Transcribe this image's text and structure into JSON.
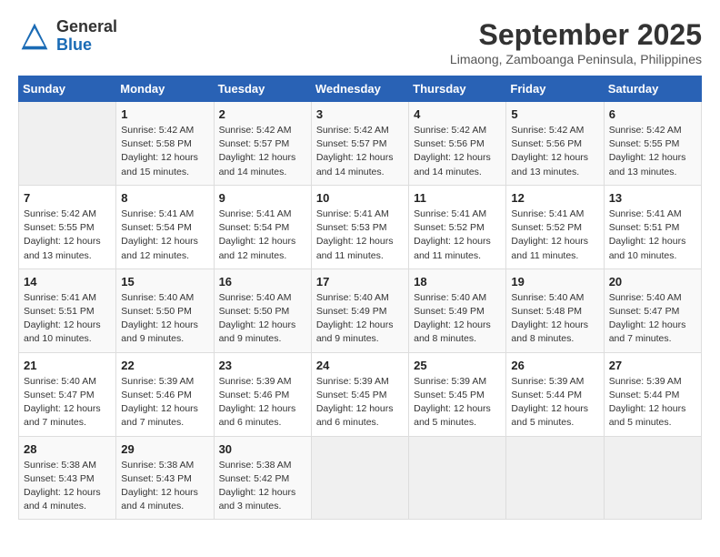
{
  "header": {
    "logo_general": "General",
    "logo_blue": "Blue",
    "month_title": "September 2025",
    "location": "Limaong, Zamboanga Peninsula, Philippines"
  },
  "days_of_week": [
    "Sunday",
    "Monday",
    "Tuesday",
    "Wednesday",
    "Thursday",
    "Friday",
    "Saturday"
  ],
  "weeks": [
    [
      {
        "day": "",
        "info": ""
      },
      {
        "day": "1",
        "info": "Sunrise: 5:42 AM\nSunset: 5:58 PM\nDaylight: 12 hours\nand 15 minutes."
      },
      {
        "day": "2",
        "info": "Sunrise: 5:42 AM\nSunset: 5:57 PM\nDaylight: 12 hours\nand 14 minutes."
      },
      {
        "day": "3",
        "info": "Sunrise: 5:42 AM\nSunset: 5:57 PM\nDaylight: 12 hours\nand 14 minutes."
      },
      {
        "day": "4",
        "info": "Sunrise: 5:42 AM\nSunset: 5:56 PM\nDaylight: 12 hours\nand 14 minutes."
      },
      {
        "day": "5",
        "info": "Sunrise: 5:42 AM\nSunset: 5:56 PM\nDaylight: 12 hours\nand 13 minutes."
      },
      {
        "day": "6",
        "info": "Sunrise: 5:42 AM\nSunset: 5:55 PM\nDaylight: 12 hours\nand 13 minutes."
      }
    ],
    [
      {
        "day": "7",
        "info": "Sunrise: 5:42 AM\nSunset: 5:55 PM\nDaylight: 12 hours\nand 13 minutes."
      },
      {
        "day": "8",
        "info": "Sunrise: 5:41 AM\nSunset: 5:54 PM\nDaylight: 12 hours\nand 12 minutes."
      },
      {
        "day": "9",
        "info": "Sunrise: 5:41 AM\nSunset: 5:54 PM\nDaylight: 12 hours\nand 12 minutes."
      },
      {
        "day": "10",
        "info": "Sunrise: 5:41 AM\nSunset: 5:53 PM\nDaylight: 12 hours\nand 11 minutes."
      },
      {
        "day": "11",
        "info": "Sunrise: 5:41 AM\nSunset: 5:52 PM\nDaylight: 12 hours\nand 11 minutes."
      },
      {
        "day": "12",
        "info": "Sunrise: 5:41 AM\nSunset: 5:52 PM\nDaylight: 12 hours\nand 11 minutes."
      },
      {
        "day": "13",
        "info": "Sunrise: 5:41 AM\nSunset: 5:51 PM\nDaylight: 12 hours\nand 10 minutes."
      }
    ],
    [
      {
        "day": "14",
        "info": "Sunrise: 5:41 AM\nSunset: 5:51 PM\nDaylight: 12 hours\nand 10 minutes."
      },
      {
        "day": "15",
        "info": "Sunrise: 5:40 AM\nSunset: 5:50 PM\nDaylight: 12 hours\nand 9 minutes."
      },
      {
        "day": "16",
        "info": "Sunrise: 5:40 AM\nSunset: 5:50 PM\nDaylight: 12 hours\nand 9 minutes."
      },
      {
        "day": "17",
        "info": "Sunrise: 5:40 AM\nSunset: 5:49 PM\nDaylight: 12 hours\nand 9 minutes."
      },
      {
        "day": "18",
        "info": "Sunrise: 5:40 AM\nSunset: 5:49 PM\nDaylight: 12 hours\nand 8 minutes."
      },
      {
        "day": "19",
        "info": "Sunrise: 5:40 AM\nSunset: 5:48 PM\nDaylight: 12 hours\nand 8 minutes."
      },
      {
        "day": "20",
        "info": "Sunrise: 5:40 AM\nSunset: 5:47 PM\nDaylight: 12 hours\nand 7 minutes."
      }
    ],
    [
      {
        "day": "21",
        "info": "Sunrise: 5:40 AM\nSunset: 5:47 PM\nDaylight: 12 hours\nand 7 minutes."
      },
      {
        "day": "22",
        "info": "Sunrise: 5:39 AM\nSunset: 5:46 PM\nDaylight: 12 hours\nand 7 minutes."
      },
      {
        "day": "23",
        "info": "Sunrise: 5:39 AM\nSunset: 5:46 PM\nDaylight: 12 hours\nand 6 minutes."
      },
      {
        "day": "24",
        "info": "Sunrise: 5:39 AM\nSunset: 5:45 PM\nDaylight: 12 hours\nand 6 minutes."
      },
      {
        "day": "25",
        "info": "Sunrise: 5:39 AM\nSunset: 5:45 PM\nDaylight: 12 hours\nand 5 minutes."
      },
      {
        "day": "26",
        "info": "Sunrise: 5:39 AM\nSunset: 5:44 PM\nDaylight: 12 hours\nand 5 minutes."
      },
      {
        "day": "27",
        "info": "Sunrise: 5:39 AM\nSunset: 5:44 PM\nDaylight: 12 hours\nand 5 minutes."
      }
    ],
    [
      {
        "day": "28",
        "info": "Sunrise: 5:38 AM\nSunset: 5:43 PM\nDaylight: 12 hours\nand 4 minutes."
      },
      {
        "day": "29",
        "info": "Sunrise: 5:38 AM\nSunset: 5:43 PM\nDaylight: 12 hours\nand 4 minutes."
      },
      {
        "day": "30",
        "info": "Sunrise: 5:38 AM\nSunset: 5:42 PM\nDaylight: 12 hours\nand 3 minutes."
      },
      {
        "day": "",
        "info": ""
      },
      {
        "day": "",
        "info": ""
      },
      {
        "day": "",
        "info": ""
      },
      {
        "day": "",
        "info": ""
      }
    ]
  ]
}
